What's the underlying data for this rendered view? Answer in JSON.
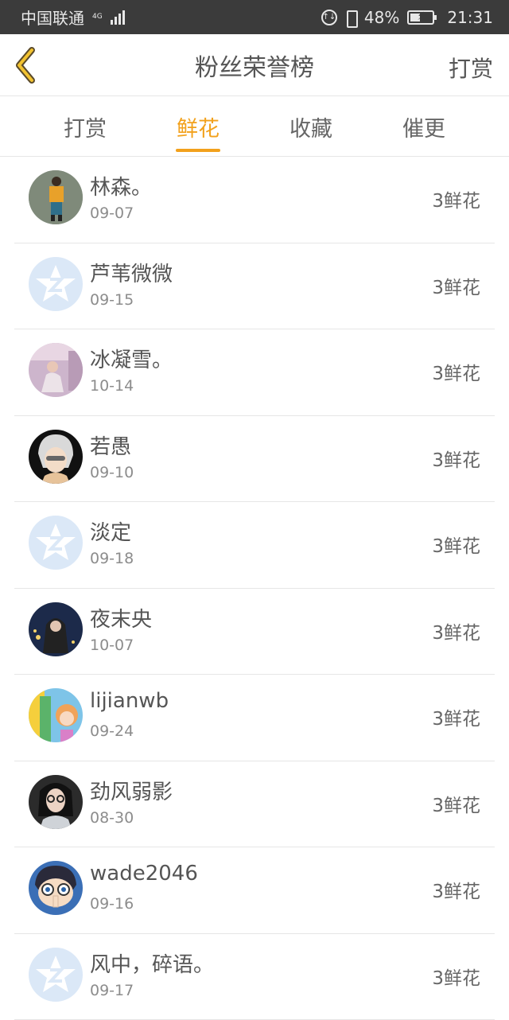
{
  "status_bar": {
    "carrier": "中国联通",
    "network": "4G",
    "battery": "48%",
    "battery_level": 0.48,
    "time": "21:31"
  },
  "header": {
    "title": "粉丝荣誉榜",
    "action": "打赏",
    "back_icon": "chevron-left-icon",
    "accent_color": "#f2a11c"
  },
  "tabs": [
    {
      "label": "打赏",
      "active": false
    },
    {
      "label": "鲜花",
      "active": true
    },
    {
      "label": "收藏",
      "active": false
    },
    {
      "label": "催更",
      "active": false
    }
  ],
  "fans": [
    {
      "name": "林森。",
      "date": "09-07",
      "count": "3鲜花",
      "avatar": "photo-person-yellow"
    },
    {
      "name": "芦苇微微",
      "date": "09-15",
      "count": "3鲜花",
      "avatar": "default-avatar"
    },
    {
      "name": "冰凝雪。",
      "date": "10-14",
      "count": "3鲜花",
      "avatar": "photo-girl-pink"
    },
    {
      "name": "若愚",
      "date": "09-10",
      "count": "3鲜花",
      "avatar": "anime-white-hair"
    },
    {
      "name": "淡定",
      "date": "09-18",
      "count": "3鲜花",
      "avatar": "default-avatar"
    },
    {
      "name": "夜末央",
      "date": "10-07",
      "count": "3鲜花",
      "avatar": "photo-dark-blue"
    },
    {
      "name": "lijianwb",
      "date": "09-24",
      "count": "3鲜花",
      "avatar": "cartoon-colorful"
    },
    {
      "name": "劲风弱影",
      "date": "08-30",
      "count": "3鲜花",
      "avatar": "photo-glasses-girl"
    },
    {
      "name": "wade2046",
      "date": "09-16",
      "count": "3鲜花",
      "avatar": "anime-conan"
    },
    {
      "name": "风中，碎语。",
      "date": "09-17",
      "count": "3鲜花",
      "avatar": "default-avatar"
    }
  ]
}
